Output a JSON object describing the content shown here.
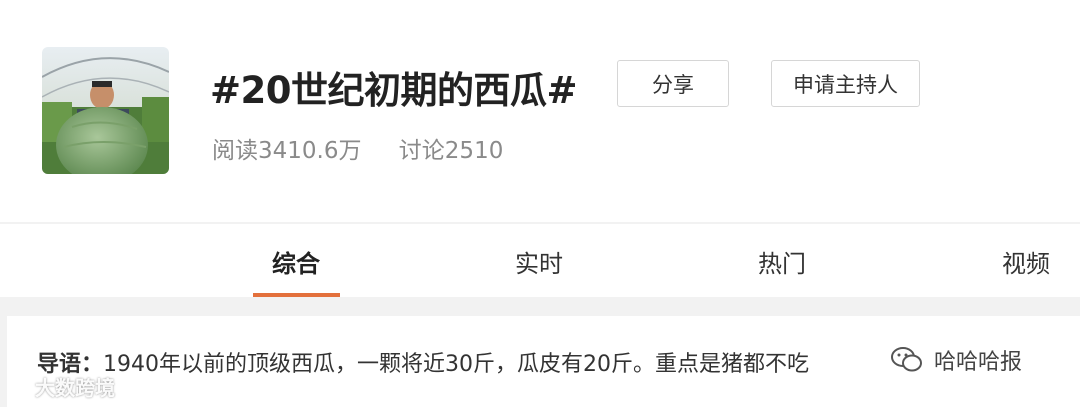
{
  "topic": {
    "title": "#20世纪初期的西瓜#",
    "avatar_icon": "man-holding-watermelon-photo",
    "share_label": "分享",
    "host_label": "申请主持人",
    "reads": "阅读3410.6万",
    "discussions": "讨论2510"
  },
  "tabs": [
    {
      "label": "综合",
      "active": true
    },
    {
      "label": "实时",
      "active": false
    },
    {
      "label": "热门",
      "active": false
    },
    {
      "label": "视频",
      "active": false
    }
  ],
  "lead": {
    "label": "导语：",
    "text": "1940年以前的顶级西瓜，一颗将近30斤，瓜皮有20斤。重点是猪都不吃"
  },
  "watermarks": {
    "left": "大数跨境",
    "right": "哈哈哈报"
  },
  "colors": {
    "accent": "#e3703c",
    "muted_text": "#8a8a8a",
    "background": "#f2f2f2"
  }
}
